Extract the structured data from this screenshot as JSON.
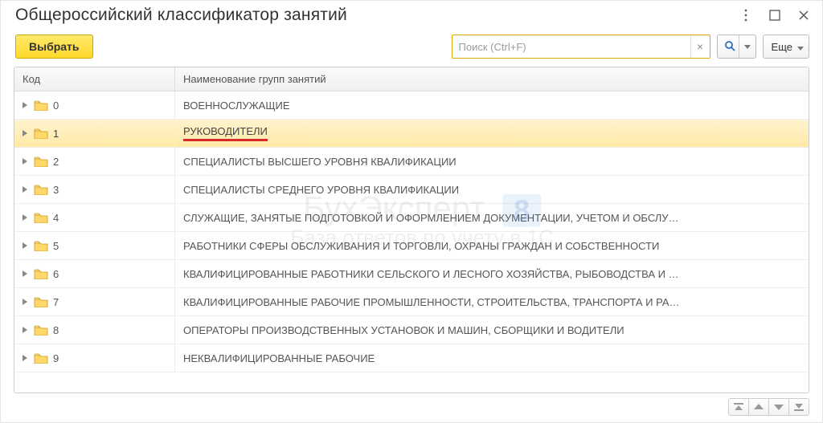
{
  "title": "Общероссийский классификатор занятий",
  "toolbar": {
    "select_label": "Выбрать",
    "more_label": "Еще"
  },
  "search": {
    "placeholder": "Поиск (Ctrl+F)",
    "value": ""
  },
  "columns": {
    "code": "Код",
    "name": "Наименование групп занятий"
  },
  "rows": [
    {
      "code": "0",
      "name": "ВОЕННОСЛУЖАЩИЕ",
      "selected": false
    },
    {
      "code": "1",
      "name": "РУКОВОДИТЕЛИ",
      "selected": true,
      "underline": true
    },
    {
      "code": "2",
      "name": "СПЕЦИАЛИСТЫ ВЫСШЕГО УРОВНЯ КВАЛИФИКАЦИИ",
      "selected": false
    },
    {
      "code": "3",
      "name": "СПЕЦИАЛИСТЫ СРЕДНЕГО УРОВНЯ КВАЛИФИКАЦИИ",
      "selected": false
    },
    {
      "code": "4",
      "name": "СЛУЖАЩИЕ, ЗАНЯТЫЕ ПОДГОТОВКОЙ И ОФОРМЛЕНИЕМ ДОКУМЕНТАЦИИ, УЧЕТОМ И ОБСЛУ…",
      "selected": false
    },
    {
      "code": "5",
      "name": "РАБОТНИКИ СФЕРЫ ОБСЛУЖИВАНИЯ И ТОРГОВЛИ, ОХРАНЫ ГРАЖДАН И СОБСТВЕННОСТИ",
      "selected": false
    },
    {
      "code": "6",
      "name": "КВАЛИФИЦИРОВАННЫЕ РАБОТНИКИ СЕЛЬСКОГО И ЛЕСНОГО ХОЗЯЙСТВА, РЫБОВОДСТВА И …",
      "selected": false
    },
    {
      "code": "7",
      "name": "КВАЛИФИЦИРОВАННЫЕ РАБОЧИЕ ПРОМЫШЛЕННОСТИ, СТРОИТЕЛЬСТВА, ТРАНСПОРТА И РА…",
      "selected": false
    },
    {
      "code": "8",
      "name": "ОПЕРАТОРЫ ПРОИЗВОДСТВЕННЫХ УСТАНОВОК И МАШИН, СБОРЩИКИ И ВОДИТЕЛИ",
      "selected": false
    },
    {
      "code": "9",
      "name": "НЕКВАЛИФИЦИРОВАННЫЕ РАБОЧИЕ",
      "selected": false
    }
  ]
}
